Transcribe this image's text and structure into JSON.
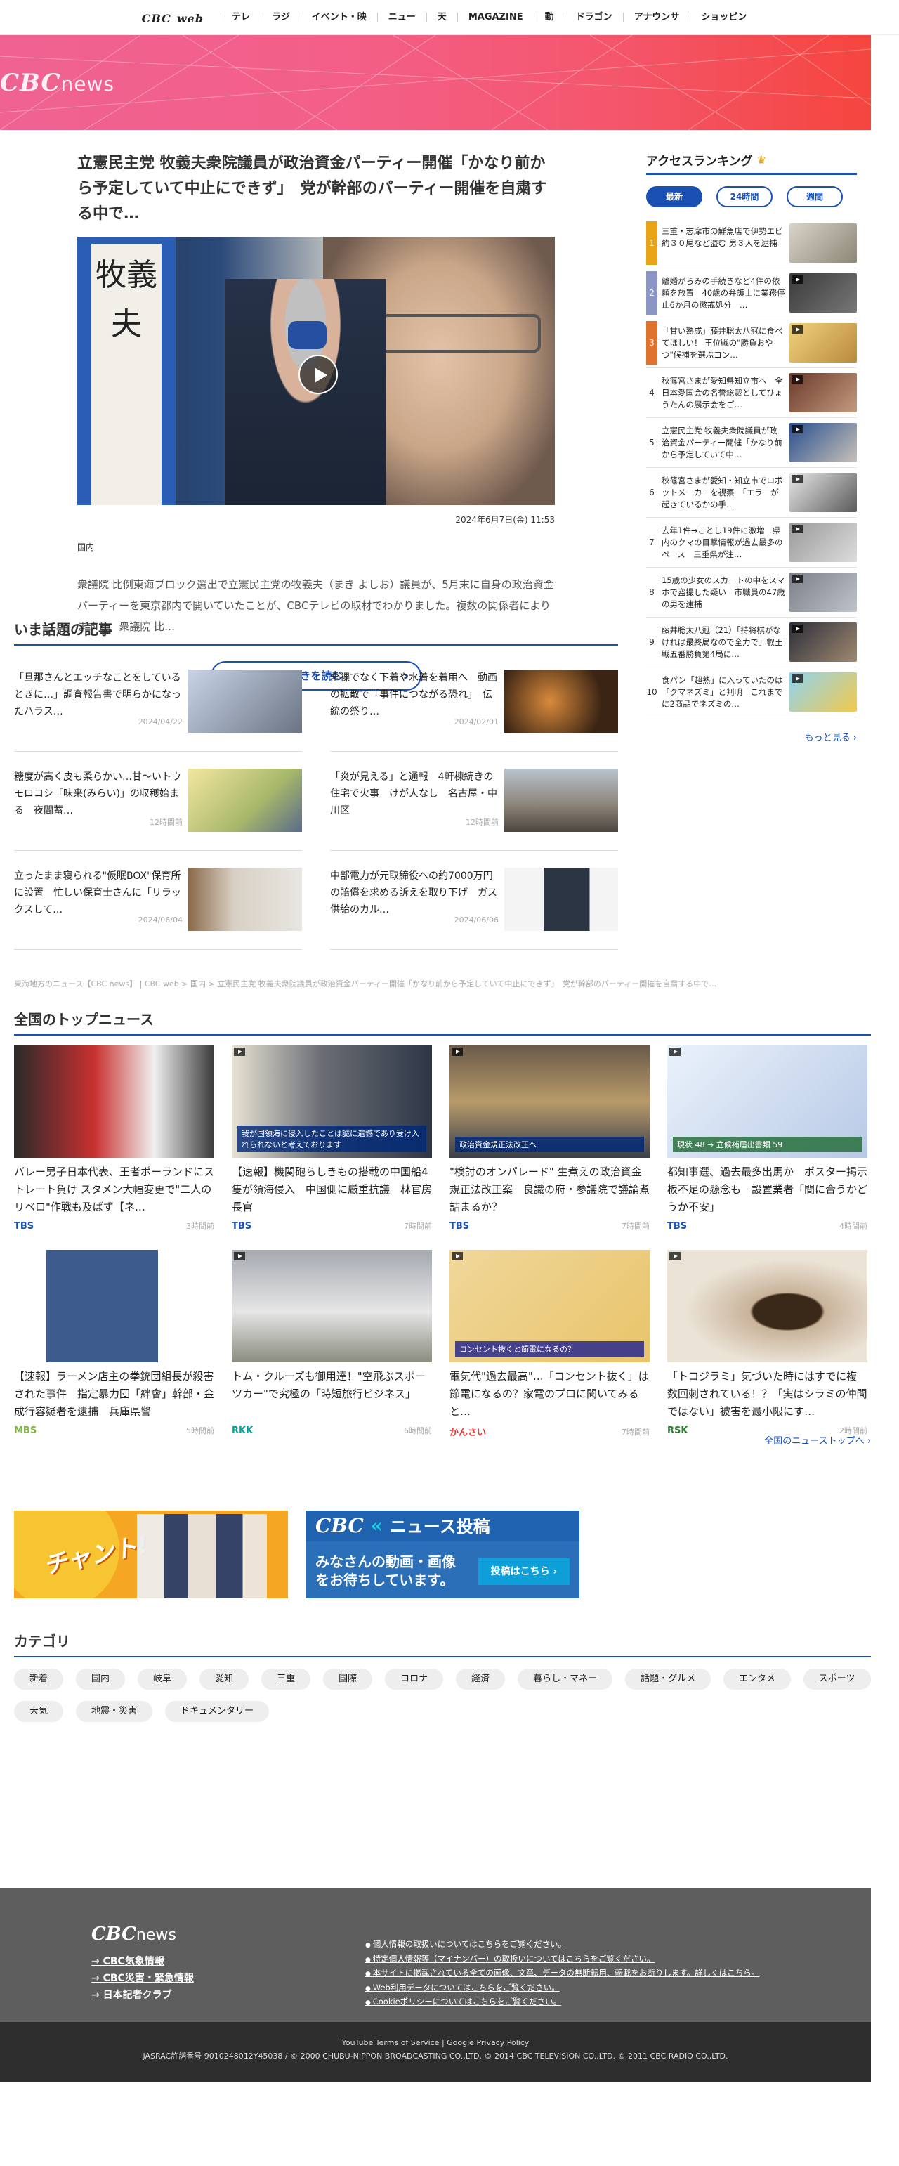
{
  "nav": {
    "logo": "CBC",
    "logo_sub": "web",
    "items": [
      "テレ",
      "ラジ",
      "イベント・映",
      "ニュー",
      "天",
      "MAGAZINE",
      "動",
      "ドラゴン",
      "アナウンサ",
      "ショッピン"
    ]
  },
  "hero": {
    "brand": "CBC",
    "brand_sub": "news"
  },
  "article": {
    "title": "立憲民主党 牧義夫衆院議員が政治資金パーティー開催「かなり前から予定していて中止にできず」　党が幹部のパーティー開催を自粛する中で…",
    "date": "2024年6月7日(金) 11:53",
    "category": "国内",
    "lead": "衆議院 比例東海ブロック選出で立憲民主党の牧義夫（まき よしお）議員が、5月末に自身の政治資金パーティーを東京都内で開いていたことが、CBCテレビの取材でわかりました。複数の関係者によりますと、衆議院 比…",
    "read_more": "続きを読む",
    "photo_banner_text": "牧義夫"
  },
  "ranking": {
    "title": "アクセスランキング",
    "tabs": [
      "最新",
      "24時間",
      "週間"
    ],
    "items": [
      {
        "rank": "1",
        "title": "三重・志摩市の鮮魚店で伊勢エビ約３０尾など盗む 男３人を逮捕"
      },
      {
        "rank": "2",
        "title": "離婚がらみの手続きなど4件の依頼を放置　40歳の弁護士に業務停止6か月の懲戒処分　…"
      },
      {
        "rank": "3",
        "title": "「甘い熟成」藤井聡太八冠に食べてほしい！ 王位戦の\"勝負おやつ\"候補を選ぶコン…"
      },
      {
        "rank": "4",
        "title": "秋篠宮さまが愛知県知立市へ　全日本愛国会の名誉総裁としてひょうたんの展示会をご…"
      },
      {
        "rank": "5",
        "title": "立憲民主党 牧義夫衆院議員が政治資金パーティー開催「かなり前から予定していて中…"
      },
      {
        "rank": "6",
        "title": "秋篠宮さまが愛知・知立市でロボットメーカーを視察　「エラーが起きているかの手…"
      },
      {
        "rank": "7",
        "title": "去年1件→ことし19件に激増　県内のクマの目撃情報が過去最多のペース　三重県が注…"
      },
      {
        "rank": "8",
        "title": "15歳の少女のスカートの中をスマホで盗撮した疑い　市職員の47歳の男を逮捕"
      },
      {
        "rank": "9",
        "title": "藤井聡太八冠（21）「持将棋がなければ最終局なので全力で」叡王戦五番勝負第4局に…"
      },
      {
        "rank": "10",
        "title": "食パン「超熟」に入っていたのは「クマネズミ」と判明　これまでに2商品でネズミの…"
      }
    ],
    "more": "もっと見る"
  },
  "trending": {
    "title": "いま話題の記事",
    "items": [
      {
        "title": "「旦那さんとエッチなことをしているときに…」調査報告書で明らかになったハラス…",
        "date": "2024/04/22"
      },
      {
        "title": "全裸でなく下着や水着を着用へ　動画の拡散で「事件につながる恐れ」　伝統の祭り…",
        "date": "2024/02/01"
      },
      {
        "title": "糖度が高く皮も柔らかい…甘〜いトウモロコシ「味来(みらい)」の収穫始まる　夜間蓄…",
        "date": "12時間前"
      },
      {
        "title": "「炎が見える」と通報　4軒棟続きの住宅で火事　けが人なし　名古屋・中川区",
        "date": "12時間前"
      },
      {
        "title": "立ったまま寝られる\"仮眠BOX\"保育所に設置　忙しい保育士さんに「リラックスして…",
        "date": "2024/06/04"
      },
      {
        "title": "中部電力が元取締役への約7000万円の賠償を求める訴えを取り下げ　ガス供給のカル…",
        "date": "2024/06/06"
      }
    ]
  },
  "breadcrumb": "東海地方のニュース【CBC news】 | CBC web > 国内 > 立憲民主党 牧義夫衆院議員が政治資金パーティー開催「かなり前から予定していて中止にできず」　党が幹部のパーティー開催を自粛する中で…",
  "topnews": {
    "title": "全国のトップニュース",
    "items": [
      {
        "title": "バレー男子日本代表、王者ポーランドにストレート負け スタメン大幅変更で\"二人のリベロ\"作戦も及ばず【ネ…",
        "source": "TBS",
        "time": "3時間前",
        "caption": ""
      },
      {
        "title": "【速報】機関砲らしきもの搭載の中国船4隻が領海侵入　中国側に厳重抗議　林官房長官",
        "source": "TBS",
        "time": "7時間前",
        "caption": "我が国領海に侵入したことは誠に遺憾であり受け入れられないと考えております"
      },
      {
        "title": "\"検討のオンパレード\" 生煮えの政治資金規正法改正案　良識の府・参議院で議論煮詰まるか？",
        "source": "TBS",
        "time": "7時間前",
        "caption": "政治資金規正法改正へ"
      },
      {
        "title": "都知事選、過去最多出馬か　ポスター掲示板不足の懸念も　設置業者「間に合うかどうか不安」",
        "source": "TBS",
        "time": "4時間前",
        "caption": "現状 48 → 立候補届出書類 59"
      },
      {
        "title": "【速報】ラーメン店主の拳銃団組長が殺害された事件　指定暴力団「絆會」幹部・金成行容疑者を逮捕　兵庫県警",
        "source": "MBS",
        "time": "5時間前",
        "caption": ""
      },
      {
        "title": "トム・クルーズも御用達！\"空飛ぶスポーツカー\"で究極の「時短旅行ビジネス」",
        "source": "RKK",
        "time": "6時間前",
        "caption": ""
      },
      {
        "title": "電気代\"過去最高\"…「コンセント抜く」は節電になるの？家電のプロに聞いてみると…",
        "source": "かんさい",
        "time": "7時間前",
        "caption": "コンセント抜くと節電になるの？"
      },
      {
        "title": "「トコジラミ」気づいた時にはすでに複数回刺されている！？「実はシラミの仲間ではない」被害を最小限にす…",
        "source": "RSK",
        "time": "2時間前",
        "caption": ""
      }
    ],
    "all_link": "全国のニューストップへ"
  },
  "banners": {
    "chant_text": "チャント!",
    "post_title": "CBC",
    "post_title_sub": "ニュース投稿",
    "post_sub": "みなさんの動画・画像をお待ちしています。",
    "post_button": "投稿はこちら"
  },
  "categories": {
    "title": "カテゴリ",
    "items": [
      "新着",
      "国内",
      "岐阜",
      "愛知",
      "三重",
      "国際",
      "コロナ",
      "経済",
      "暮らし・マネー",
      "話題・グルメ",
      "エンタメ",
      "スポーツ",
      "天気",
      "地震・災害",
      "ドキュメンタリー"
    ]
  },
  "footer": {
    "logo": "CBC",
    "logo_sub": "news",
    "links": [
      "CBC気象情報",
      "CBC災害・緊急情報",
      "日本記者クラブ"
    ],
    "notices": [
      "個人情報の取扱いについてはこちらをご覧ください。",
      "特定個人情報等（マイナンバー）の取扱いについてはこちらをご覧ください。",
      "本サイトに掲載されている全ての画像、文章、データの無断転用、転載をお断りします。詳しくはこちら。",
      "Web利用データについてはこちらをご覧ください。",
      "Cookieポリシーについてはこちらをご覧ください。"
    ],
    "terms": "YouTube Terms of Service",
    "privacy": "Google Privacy Policy",
    "copyright": "JASRAC許諾番号 9010248012Y45038 / © 2000 CHUBU-NIPPON BROADCASTING CO.,LTD. © 2014 CBC TELEVISION CO.,LTD. © 2011 CBC RADIO CO.,LTD."
  },
  "colors": {
    "accent": "#1a4fb3",
    "hero_start": "#f06292",
    "hero_end": "#f5453e"
  }
}
